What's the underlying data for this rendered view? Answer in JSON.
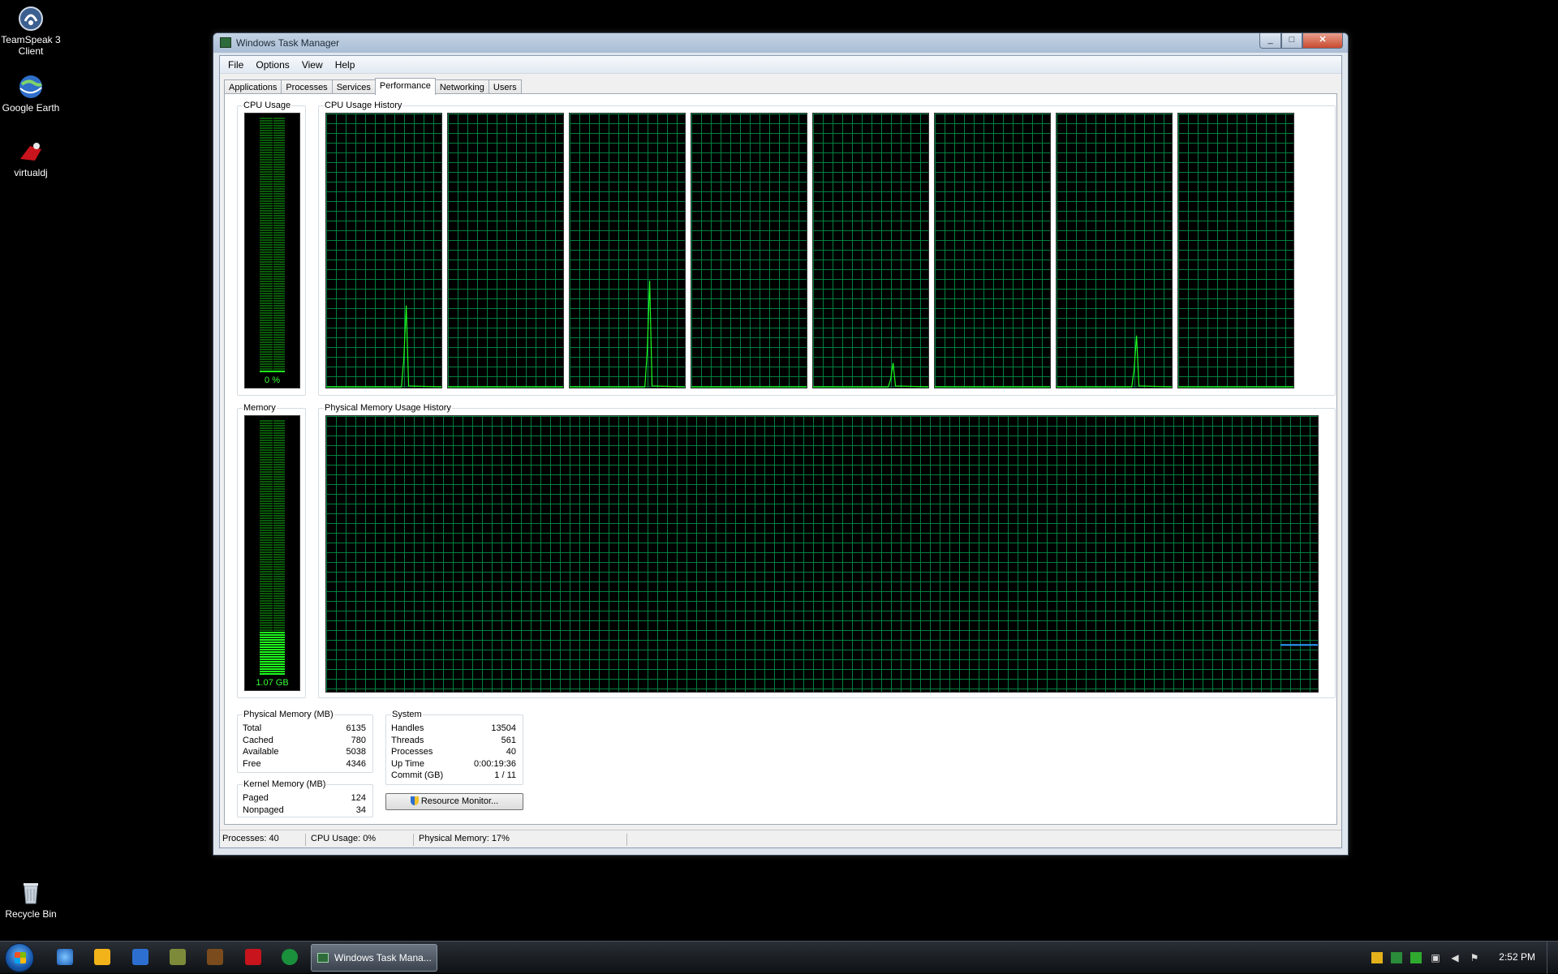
{
  "desktop": {
    "icons": [
      {
        "label": "TeamSpeak 3 Client",
        "icon": "teamspeak-icon"
      },
      {
        "label": "Google Earth",
        "icon": "google-earth-icon"
      },
      {
        "label": "virtualdj",
        "icon": "virtualdj-icon"
      },
      {
        "label": "Recycle Bin",
        "icon": "recycle-bin-icon"
      }
    ]
  },
  "window": {
    "title": "Windows Task Manager",
    "buttons": {
      "minimize": "_",
      "maximize": "□",
      "close": "✕"
    },
    "menu": [
      "File",
      "Options",
      "View",
      "Help"
    ],
    "tabs": [
      "Applications",
      "Processes",
      "Services",
      "Performance",
      "Networking",
      "Users"
    ],
    "active_tab": "Performance"
  },
  "performance": {
    "cpu_usage_label": "CPU Usage",
    "cpu_usage_value": "0 %",
    "cpu_usage_fraction": 0.0,
    "cpu_history_label": "CPU Usage History",
    "memory_label": "Memory",
    "memory_value": "1.07 GB",
    "memory_fraction": 0.17,
    "memory_history_label": "Physical Memory Usage History",
    "physical_memory": {
      "title": "Physical Memory (MB)",
      "rows": [
        {
          "k": "Total",
          "v": "6135"
        },
        {
          "k": "Cached",
          "v": "780"
        },
        {
          "k": "Available",
          "v": "5038"
        },
        {
          "k": "Free",
          "v": "4346"
        }
      ]
    },
    "kernel_memory": {
      "title": "Kernel Memory (MB)",
      "rows": [
        {
          "k": "Paged",
          "v": "124"
        },
        {
          "k": "Nonpaged",
          "v": "34"
        }
      ]
    },
    "system": {
      "title": "System",
      "rows": [
        {
          "k": "Handles",
          "v": "13504"
        },
        {
          "k": "Threads",
          "v": "561"
        },
        {
          "k": "Processes",
          "v": "40"
        },
        {
          "k": "Up Time",
          "v": "0:00:19:36"
        },
        {
          "k": "Commit (GB)",
          "v": "1 / 11"
        }
      ]
    },
    "resource_monitor_button": "Resource Monitor..."
  },
  "statusbar": {
    "processes": "Processes: 40",
    "cpu": "CPU Usage: 0%",
    "memory": "Physical Memory: 17%"
  },
  "taskbar": {
    "active_task": "Windows Task Mana...",
    "clock": "2:52 PM",
    "pinned": [
      "internet-explorer-icon",
      "outlook-icon",
      "app-icon",
      "game-icon",
      "warcraft-icon",
      "virtualdj-icon",
      "utorrent-icon"
    ]
  },
  "chart_data": [
    {
      "type": "line",
      "title": "CPU Usage History",
      "cores": 8,
      "y_range": [
        0,
        100
      ],
      "spikes": [
        {
          "core": 0,
          "peak": 30
        },
        {
          "core": 2,
          "peak": 39
        },
        {
          "core": 4,
          "peak": 9
        },
        {
          "core": 6,
          "peak": 19
        }
      ]
    },
    {
      "type": "line",
      "title": "Physical Memory Usage History",
      "y_range": [
        0,
        100
      ],
      "recent_value": 17
    }
  ],
  "colors": {
    "graph_grid": "#008040",
    "graph_line": "#1eff1e",
    "memory_line": "#2b9bff",
    "desktop": "#000000"
  }
}
